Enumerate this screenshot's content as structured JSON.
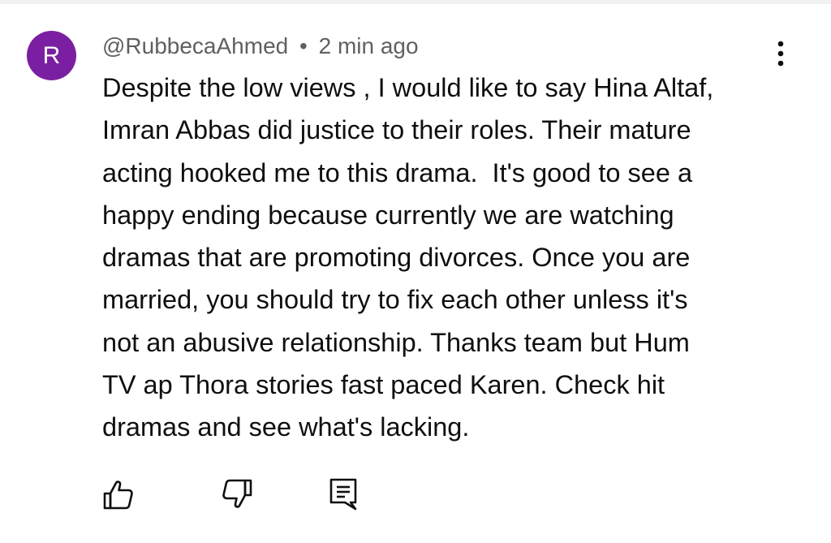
{
  "comment": {
    "avatar_letter": "R",
    "avatar_color": "#7b1fa2",
    "author": "@RubbecaAhmed",
    "separator": "•",
    "timestamp": "2 min ago",
    "text_lines": [
      "Despite the low views , I would like to say Hina Altaf,",
      "Imran Abbas did justice to their roles. Their mature",
      "acting hooked me to this drama.  It's good to see a",
      "happy ending because currently we are watching",
      "dramas that are promoting divorces. Once you are",
      "married, you should try to fix each other unless it's",
      "not an abusive relationship. Thanks team but Hum",
      "TV ap Thora stories fast paced Karen. Check hit",
      "dramas and see what's lacking."
    ]
  },
  "icons": {
    "menu": "more-vert-icon",
    "like": "thumb-up-icon",
    "dislike": "thumb-down-icon",
    "reply": "reply-comment-icon"
  }
}
